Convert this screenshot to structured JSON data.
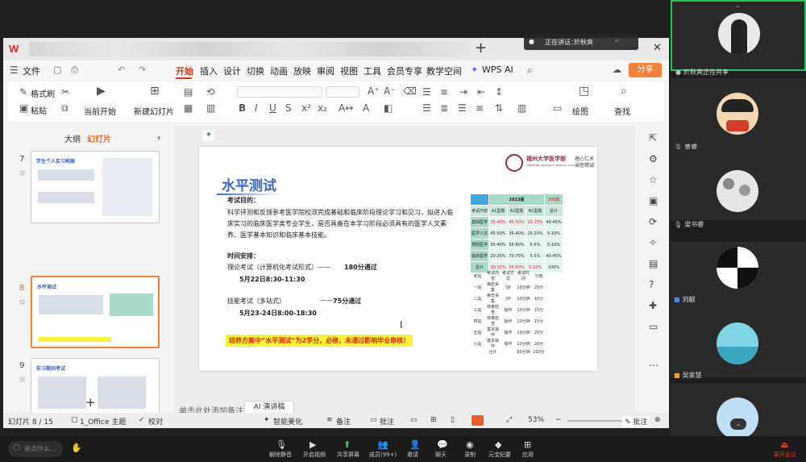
{
  "wps": {
    "logo": "W",
    "new_tab": "+",
    "menu": {
      "file": "文件",
      "tabs": [
        "开始",
        "插入",
        "设计",
        "切换",
        "动画",
        "放映",
        "审阅",
        "视图",
        "工具",
        "会员专享",
        "教学空间"
      ],
      "wps_ai": "WPS AI",
      "share": "分享"
    },
    "toolbar": {
      "format_painter": "格式刷",
      "paste": "粘贴",
      "from_current": "当前开始",
      "new_slide": "新建幻灯片",
      "drawing": "绘图",
      "find": "查找"
    },
    "panel_tabs": {
      "outline": "大纲",
      "slides": "幻灯片"
    },
    "thumbnails": [
      {
        "num": "7",
        "title": "学生个人实习档案"
      },
      {
        "num": "8",
        "title": "水平测试"
      },
      {
        "num": "9",
        "title": "实习期间考试"
      }
    ],
    "notes_placeholder": "单击此处添加备注",
    "ai_script": "AI 演讲稿",
    "status": {
      "slide": "幻灯片 8 / 15",
      "theme": "1_Office 主题",
      "proofread": "校对",
      "beautify": "智能美化",
      "notes": "备注",
      "comment": "批注",
      "zoom": "53%",
      "annotate": "批注"
    }
  },
  "slide": {
    "title": "水平测试",
    "school_name": "福州大学医学部",
    "school_sub": "SHENZHEN UNIVERSITY MEDICAL SCHOOL",
    "motto": "理心仁术 深医精诚",
    "purpose_label": "考试目的：",
    "purpose_text": "科学评测和反馈参考医学院校须完成基础和临床阶段理论学习和见习，拟进入临床实习的临床医学类专业学生，是否具备在本学习阶段必须具有的医学人文素养、医学基本知识和临床基本技能。",
    "schedule_label": "时间安排：",
    "theory_exam": "理论考试（计算机化考试形式）——",
    "theory_pass": "180分通过",
    "theory_date": "5月22日8:30-11:30",
    "skill_exam": "技能考试（多站式）",
    "skill_sep": "——",
    "skill_pass": "75分通过",
    "skill_date": "5月23-24日8:00-18:30",
    "highlight": "培养方案中“水平测试”为2学分，必修，未通过影响毕业审核！",
    "score_table": {
      "header_year": "2023版",
      "header_total": "300题",
      "cols": [
        "考试内容",
        "A1型题",
        "A2型题",
        "B1型题",
        "总计"
      ],
      "rows": [
        [
          "基础医学",
          "35-40%",
          "45-50%",
          "10-15%",
          "40-45%"
        ],
        [
          "医学人文",
          "45-50%",
          "35-40%",
          "15-20%",
          "5-10%"
        ],
        [
          "预防医学",
          "35-40%",
          "55-60%",
          "5-5%",
          "5-10%"
        ],
        [
          "临床医学",
          "20-25%",
          "70-75%",
          "5-5%",
          "40-45%"
        ],
        [
          "总计",
          "30-35%",
          "55-60%",
          "5-10%",
          "100%"
        ]
      ]
    },
    "exam_table": {
      "cols": [
        "考站",
        "考试内容",
        "考试方式",
        "考试时间",
        "分值"
      ],
      "rows": [
        [
          "一站",
          "病史采集",
          "SP",
          "10分钟",
          "20分"
        ],
        [
          "二站",
          "病史采集",
          "SP",
          "10分钟",
          "10分"
        ],
        [
          "三站",
          "体格检查",
          "操作",
          "10分钟",
          "15分"
        ],
        [
          "四站",
          "体格检查",
          "操作",
          "10分钟",
          "15分"
        ],
        [
          "五站",
          "基本操作",
          "操作",
          "10分钟",
          "20分"
        ],
        [
          "六站",
          "基本操作",
          "操作",
          "10分钟",
          "20分"
        ],
        [
          "",
          "合计",
          "",
          "60分钟",
          "100分"
        ]
      ]
    }
  },
  "meeting": {
    "speaking_label": "正在讲话：",
    "speaking_name": "於秋爽",
    "sharing": "於秋爽正在共享",
    "participants": [
      "黄睿",
      "梁书睿",
      "刘靓",
      "吴家慧"
    ],
    "input_placeholder": "说点什么...",
    "controls": [
      "解除静音",
      "开启视频",
      "共享屏幕",
      "成员(99+)",
      "邀请",
      "聊天",
      "录制",
      "元宝纪要",
      "应用"
    ],
    "leave": "离开会议"
  }
}
